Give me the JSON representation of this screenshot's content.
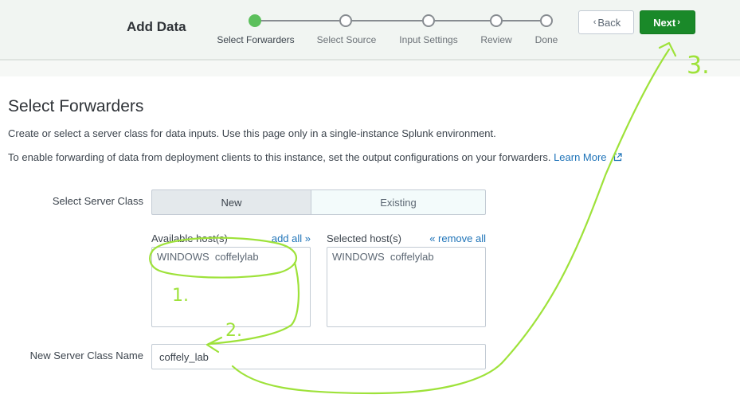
{
  "header": {
    "title": "Add Data",
    "steps": [
      {
        "label": "Select Forwarders",
        "active": true
      },
      {
        "label": "Select Source",
        "active": false
      },
      {
        "label": "Input Settings",
        "active": false
      },
      {
        "label": "Review",
        "active": false
      },
      {
        "label": "Done",
        "active": false
      }
    ],
    "back_label": "Back",
    "next_label": "Next"
  },
  "page": {
    "title": "Select Forwarders",
    "description1": "Create or select a server class for data inputs. Use this page only in a single-instance Splunk environment.",
    "description2": "To enable forwarding of data from deployment clients to this instance, set the output configurations on your forwarders.",
    "learn_more": "Learn More"
  },
  "form": {
    "server_class_label": "Select Server Class",
    "server_class_options": [
      "New",
      "Existing"
    ],
    "server_class_selected": "New",
    "available_hosts_label": "Available host(s)",
    "add_all": "add all »",
    "selected_hosts_label": "Selected host(s)",
    "remove_all": "« remove all",
    "available_hosts": [
      "WINDOWS  coffelylab"
    ],
    "selected_hosts": [
      "WINDOWS  coffelylab"
    ],
    "new_class_name_label": "New Server Class Name",
    "new_class_name_value": "coffely_lab"
  },
  "annotations": [
    "1.",
    "2.",
    "3."
  ],
  "colors": {
    "accent_green": "#1a8929",
    "step_active": "#5cc05c",
    "link": "#1e73b8",
    "annotation": "#9ee23a"
  }
}
